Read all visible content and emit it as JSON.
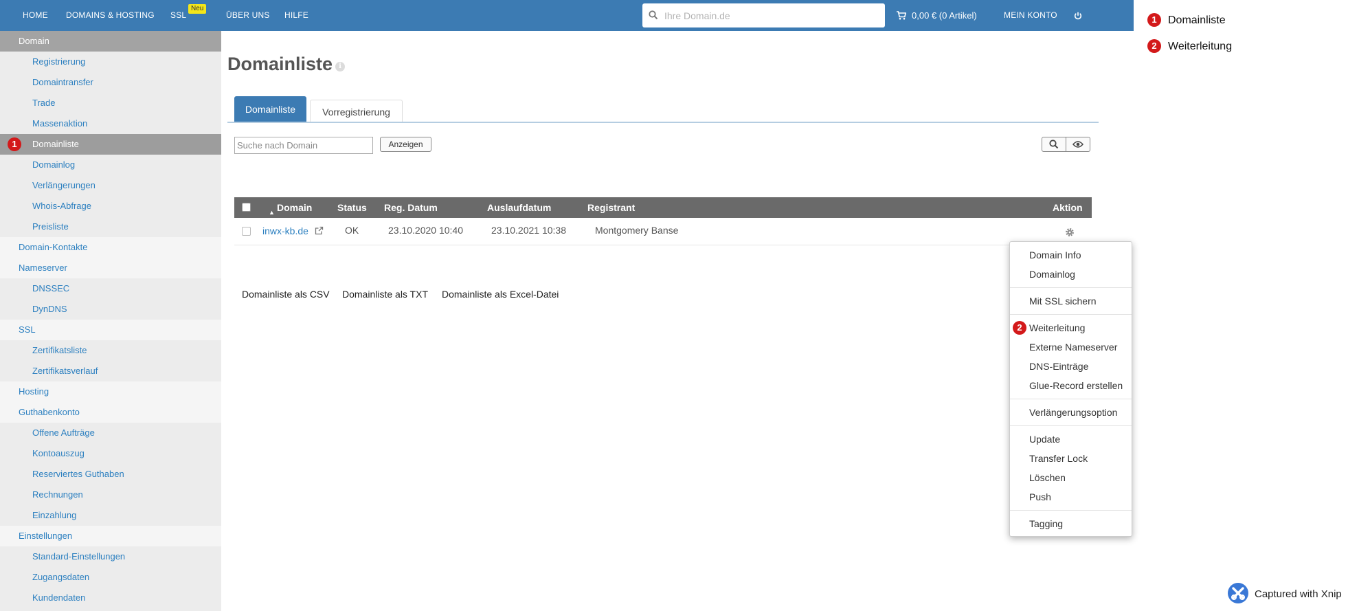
{
  "topnav": {
    "items": [
      "Home",
      "Domains & Hosting",
      "SSL",
      "Über uns",
      "Hilfe"
    ],
    "ssl_badge": "Neu",
    "search_placeholder": "Ihre Domain.de",
    "cart": "0,00 € (0 Artikel)",
    "account": "Mein Konto"
  },
  "sidebar": {
    "header": "Domain",
    "items": [
      {
        "label": "Registrierung",
        "level": 2
      },
      {
        "label": "Domaintransfer",
        "level": 2
      },
      {
        "label": "Trade",
        "level": 2
      },
      {
        "label": "Massenaktion",
        "level": 2
      },
      {
        "label": "Domainliste",
        "level": 2,
        "active": true,
        "badge": "1"
      },
      {
        "label": "Domainlog",
        "level": 2
      },
      {
        "label": "Verlängerungen",
        "level": 2
      },
      {
        "label": "Whois-Abfrage",
        "level": 2
      },
      {
        "label": "Preisliste",
        "level": 2
      },
      {
        "label": "Domain-Kontakte",
        "level": 1
      },
      {
        "label": "Nameserver",
        "level": 1
      },
      {
        "label": "DNSSEC",
        "level": 2
      },
      {
        "label": "DynDNS",
        "level": 2
      },
      {
        "label": "SSL",
        "level": 1
      },
      {
        "label": "Zertifikatsliste",
        "level": 2
      },
      {
        "label": "Zertifikatsverlauf",
        "level": 2
      },
      {
        "label": "Hosting",
        "level": 1
      },
      {
        "label": "Guthabenkonto",
        "level": 1
      },
      {
        "label": "Offene Aufträge",
        "level": 2
      },
      {
        "label": "Kontoauszug",
        "level": 2
      },
      {
        "label": "Reserviertes Guthaben",
        "level": 2
      },
      {
        "label": "Rechnungen",
        "level": 2
      },
      {
        "label": "Einzahlung",
        "level": 2
      },
      {
        "label": "Einstellungen",
        "level": 1
      },
      {
        "label": "Standard-Einstellungen",
        "level": 2
      },
      {
        "label": "Zugangsdaten",
        "level": 2
      },
      {
        "label": "Kundendaten",
        "level": 2
      }
    ]
  },
  "main": {
    "title": "Domainliste",
    "tabs": [
      {
        "label": "Domainliste",
        "active": true
      },
      {
        "label": "Vorregistrierung",
        "active": false
      }
    ],
    "search_placeholder": "Suche nach Domain",
    "show_button": "Anzeigen",
    "table": {
      "headers": [
        "Domain",
        "Status",
        "Reg. Datum",
        "Auslaufdatum",
        "Registrant",
        "Aktion"
      ],
      "rows": [
        {
          "domain": "inwx-kb.de",
          "status": "OK",
          "reg_date": "23.10.2020 10:40",
          "expiry": "23.10.2021 10:38",
          "registrant": "Montgomery Banse"
        }
      ]
    },
    "exports": [
      "Domainliste als CSV",
      "Domainliste als TXT",
      "Domainliste als Excel-Datei"
    ]
  },
  "menu": {
    "groups": [
      [
        "Domain Info",
        "Domainlog"
      ],
      [
        "Mit SSL sichern"
      ],
      [
        "Weiterleitung",
        "Externe Nameserver",
        "DNS-Einträge",
        "Glue-Record erstellen"
      ],
      [
        "Verlängerungsoption"
      ],
      [
        "Update",
        "Transfer Lock",
        "Löschen",
        "Push"
      ],
      [
        "Tagging"
      ]
    ],
    "badge": "2"
  },
  "legend": [
    {
      "num": "1",
      "label": "Domainliste"
    },
    {
      "num": "2",
      "label": "Weiterleitung"
    }
  ],
  "watermark": "Captured with Xnip",
  "colors": {
    "nav": "#3c7bb3",
    "link": "#2d80c0",
    "badge": "#d3191a",
    "ssl_badge": "#f3e61a"
  }
}
